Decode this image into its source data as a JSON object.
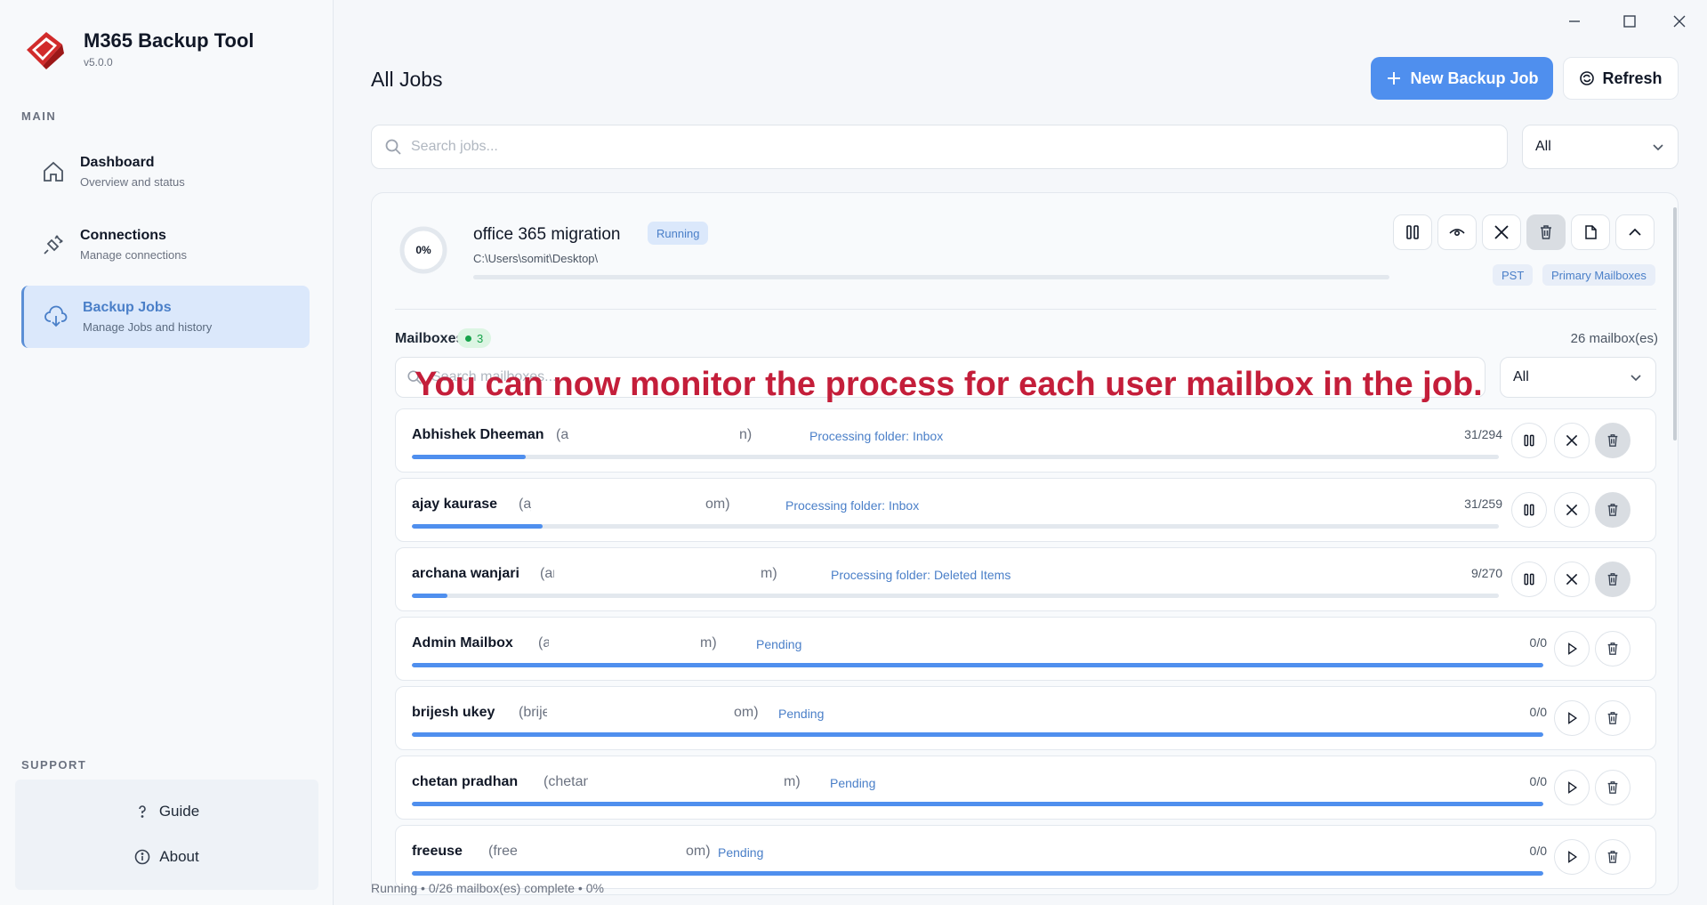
{
  "app": {
    "title": "M365 Backup Tool",
    "version": "v5.0.0"
  },
  "sidebar": {
    "main_label": "MAIN",
    "items": [
      {
        "title": "Dashboard",
        "subtitle": "Overview and status",
        "icon": "home-icon"
      },
      {
        "title": "Connections",
        "subtitle": "Manage connections",
        "icon": "plug-icon"
      },
      {
        "title": "Backup Jobs",
        "subtitle": "Manage Jobs and history",
        "icon": "cloud-download-icon",
        "active": true
      }
    ],
    "support_label": "SUPPORT",
    "support": [
      {
        "label": "Guide",
        "icon": "question-icon"
      },
      {
        "label": "About",
        "icon": "info-icon"
      }
    ]
  },
  "header": {
    "title": "All Jobs",
    "new_label": "New Backup Job",
    "refresh_label": "Refresh",
    "search_placeholder": "Search jobs...",
    "filter_value": "All"
  },
  "job": {
    "percent": "0%",
    "progress": 0,
    "name": "office 365 migration",
    "status": "Running",
    "path": "C:\\Users\\somit\\Desktop\\",
    "tags": [
      "PST",
      "Primary Mailboxes"
    ]
  },
  "mailboxes": {
    "title": "Mailboxes",
    "active_count": "3",
    "total": "26 mailbox(es)",
    "search_placeholder": "Search mailboxes...",
    "filter_value": "All",
    "rows": [
      {
        "name": "Abhishek Dheeman",
        "email_start": "(a",
        "email_end": "n)",
        "status": "Processing folder: Inbox",
        "progress": "31/294",
        "fill": 0.105,
        "state": "running"
      },
      {
        "name": "ajay kaurase",
        "email_start": "(aja",
        "email_end": "om)",
        "status": "Processing folder: Inbox",
        "progress": "31/259",
        "fill": 0.12,
        "state": "running"
      },
      {
        "name": "archana wanjari",
        "email_start": "(ar",
        "email_end": "m)",
        "status": "Processing folder: Deleted Items",
        "progress": "9/270",
        "fill": 0.033,
        "state": "running"
      },
      {
        "name": "Admin Mailbox",
        "email_start": "(ad",
        "email_end": "m)",
        "status": "Pending",
        "progress": "0/0",
        "fill": 1,
        "state": "pending"
      },
      {
        "name": "brijesh ukey",
        "email_start": "(brije:",
        "email_end": "om)",
        "status": "Pending",
        "progress": "0/0",
        "fill": 1,
        "state": "pending"
      },
      {
        "name": "chetan pradhan",
        "email_start": "(chetan",
        "email_end": "m)",
        "status": "Pending",
        "progress": "0/0",
        "fill": 1,
        "state": "pending"
      },
      {
        "name": "freeuse",
        "email_start": "(free",
        "email_end": "om)",
        "status": "Pending",
        "progress": "0/0",
        "fill": 1,
        "state": "pending"
      }
    ]
  },
  "overlay_text": "You can now monitor the process for each user mailbox in the job.",
  "footer": {
    "status": "Running • 0/26 mailbox(es) complete • 0%"
  },
  "colors": {
    "accent": "#4f8fee",
    "overlay": "#c41e3a",
    "running": "#16a34a"
  }
}
